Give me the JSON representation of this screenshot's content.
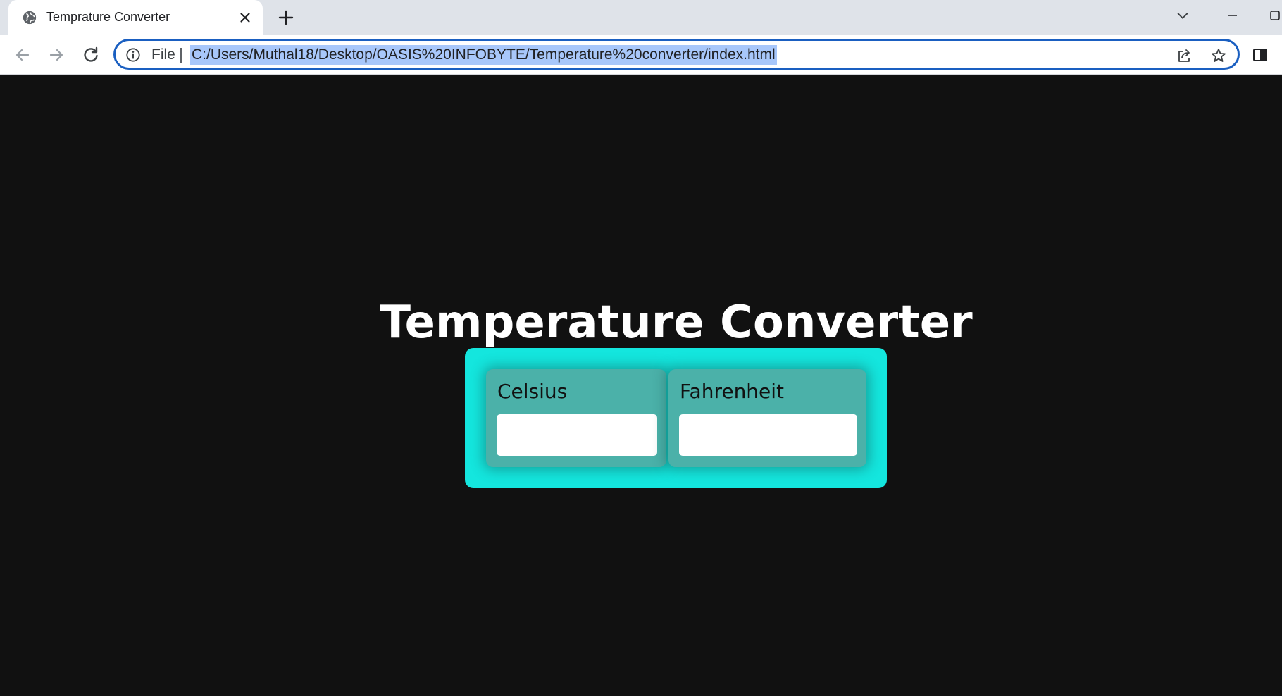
{
  "browser": {
    "tab": {
      "title": "Temprature Converter"
    },
    "address_bar": {
      "scheme_label": "File",
      "url": "C:/Users/Muthal18/Desktop/OASIS%20INFOBYTE/Temperature%20converter/index.html"
    },
    "icons": {
      "favicon": "globe-icon",
      "tab_close": "close-icon",
      "new_tab": "plus-icon",
      "tab_search": "chevron-down-icon",
      "back": "arrow-left-icon",
      "forward": "arrow-right-icon",
      "reload": "reload-icon",
      "site_info": "info-icon",
      "share": "share-icon",
      "bookmark": "star-icon",
      "side_panel": "side-panel-icon"
    },
    "colors": {
      "omnibox_border": "#1a5fc1",
      "url_highlight": "#a8c7fa"
    }
  },
  "page": {
    "title": "Temperature Converter",
    "celsius": {
      "label": "Celsius",
      "value": ""
    },
    "fahrenheit": {
      "label": "Fahrenheit",
      "value": ""
    },
    "colors": {
      "background": "#111111",
      "panel": "#14e6de",
      "card": "#4bb1a9",
      "title": "#ffffff"
    }
  }
}
